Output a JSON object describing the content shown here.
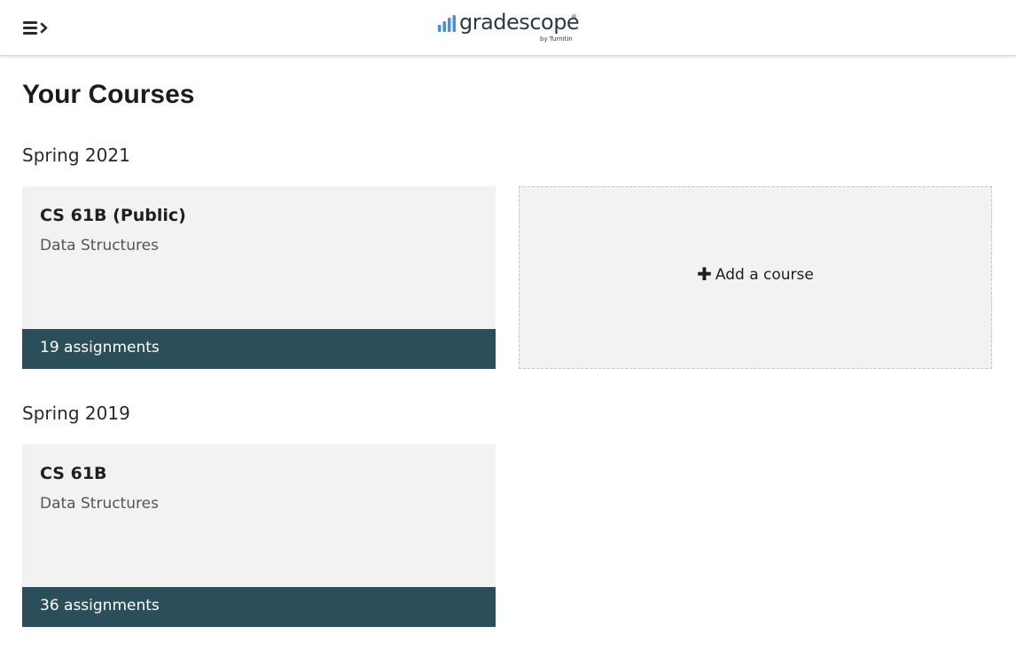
{
  "header": {
    "menu_icon": "hamburger-expand-icon",
    "logo": {
      "word": "gradescope",
      "reg_mark": "®",
      "sub": "by Turnitin",
      "bar_color": "#4a90d9",
      "text_color": "#2b3a44"
    }
  },
  "page": {
    "title": "Your Courses"
  },
  "terms": [
    {
      "name": "Spring 2021",
      "courses": [
        {
          "name": "CS 61B (Public)",
          "description": "Data Structures",
          "assignments": "19 assignments"
        }
      ],
      "add_course": {
        "icon": "plus-icon",
        "symbol": "✚",
        "label": "Add a course"
      }
    },
    {
      "name": "Spring 2019",
      "courses": [
        {
          "name": "CS 61B",
          "description": "Data Structures",
          "assignments": "36 assignments"
        }
      ]
    }
  ],
  "colors": {
    "card_bg": "#f2f2f2",
    "footer_bg": "#2b4f5a",
    "footer_text": "#ffffff"
  }
}
